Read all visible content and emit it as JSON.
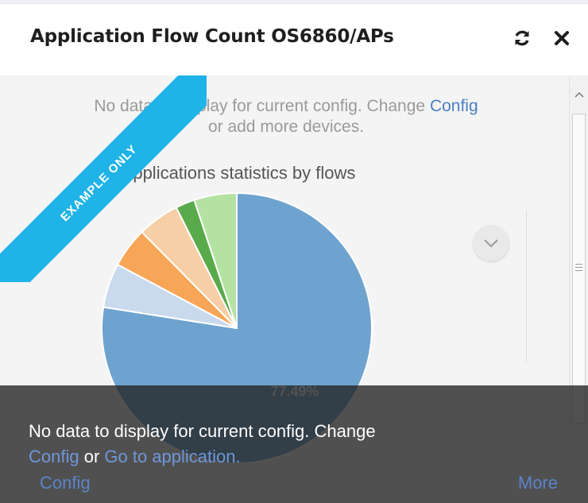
{
  "widget": {
    "title": "Application Flow Count OS6860/APs",
    "refresh_icon": "refresh-icon",
    "close_icon": "close-icon"
  },
  "body": {
    "message_prefix": "No data to display for current config. Change ",
    "message_link": "Config",
    "message_suffix": "or add more devices.",
    "ribbon": "EXAMPLE ONLY",
    "chart_menu_icon": "chevron-down-icon"
  },
  "chart_data": {
    "type": "pie",
    "title": "Applications statistics by flows",
    "slices": [
      {
        "value": 77.49,
        "label": "77.49%",
        "color": "#6ea3cf"
      },
      {
        "value": 5.3,
        "color": "#c9d9ee"
      },
      {
        "value": 4.8,
        "color": "#f6a656"
      },
      {
        "value": 5.0,
        "color": "#f7cfa6"
      },
      {
        "value": 2.3,
        "color": "#59aa4b"
      },
      {
        "value": 5.1,
        "color": "#b4e2a3"
      }
    ]
  },
  "overlay": {
    "text": "No data to display for current config. Change",
    "link1": "Config",
    "or": "or",
    "link2": "Go to application."
  },
  "footer": {
    "config": "Config",
    "more": "More"
  }
}
